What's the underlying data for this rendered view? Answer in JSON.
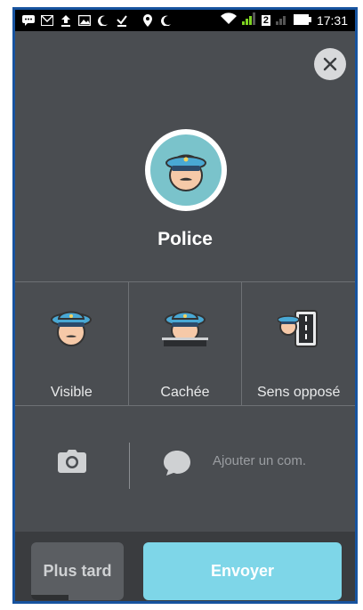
{
  "status_bar": {
    "time": "17:31",
    "network_badge": "2",
    "icons": [
      "chat-bubble-icon",
      "gmail-icon",
      "upload-icon",
      "image-icon",
      "moon-icon",
      "download-done-icon",
      "location-pin-icon",
      "moon-icon",
      "wifi-icon",
      "signal-icon",
      "signal-icon",
      "battery-icon"
    ]
  },
  "report": {
    "title": "Police",
    "close_icon": "close-icon",
    "hero_icon": "police-officer-icon"
  },
  "options": [
    {
      "label": "Visible",
      "icon": "police-visible-icon"
    },
    {
      "label": "Cachée",
      "icon": "police-hidden-icon"
    },
    {
      "label": "Sens opposé",
      "icon": "police-opposite-side-icon"
    }
  ],
  "comment": {
    "placeholder": "Ajouter un com.",
    "camera_icon": "camera-icon",
    "chat_icon": "chat-bubble-icon"
  },
  "actions": {
    "later_label": "Plus tard",
    "later_progress": 0.4,
    "send_label": "Envoyer"
  },
  "colors": {
    "accent": "#7ed6e8",
    "background": "#4a4d51",
    "police_hat": "#49a8d4"
  }
}
